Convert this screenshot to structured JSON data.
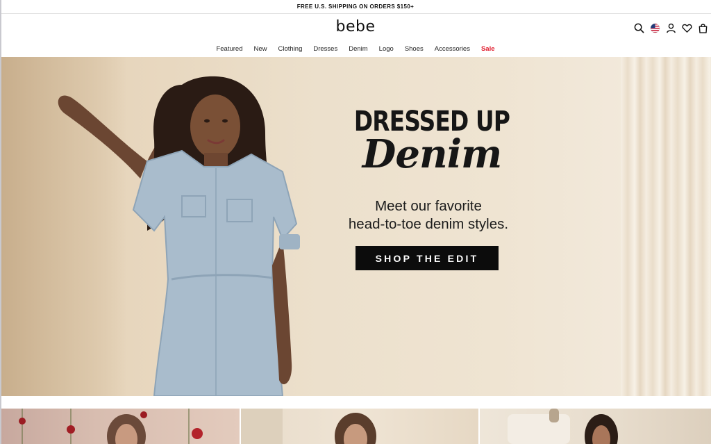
{
  "promo": {
    "text": "FREE U.S. SHIPPING ON ORDERS $150+"
  },
  "header": {
    "logo": "bebe",
    "icons": [
      "search-icon",
      "us-flag-icon",
      "account-icon",
      "wishlist-heart-icon",
      "shopping-bag-icon"
    ]
  },
  "nav": {
    "items": [
      {
        "label": "Featured"
      },
      {
        "label": "New"
      },
      {
        "label": "Clothing"
      },
      {
        "label": "Dresses"
      },
      {
        "label": "Denim"
      },
      {
        "label": "Logo"
      },
      {
        "label": "Shoes"
      },
      {
        "label": "Accessories"
      },
      {
        "label": "Sale",
        "accent": "#e01a2b"
      }
    ]
  },
  "hero": {
    "headline_1": "DRESSED UP",
    "headline_2": "Denim",
    "subcopy_1": "Meet our favorite",
    "subcopy_2": "head-to-toe denim styles.",
    "cta_label": "SHOP THE EDIT"
  },
  "colors": {
    "cta_bg": "#0c0c0c",
    "sale": "#e01a2b",
    "hero_bg": "#ece0cc"
  }
}
